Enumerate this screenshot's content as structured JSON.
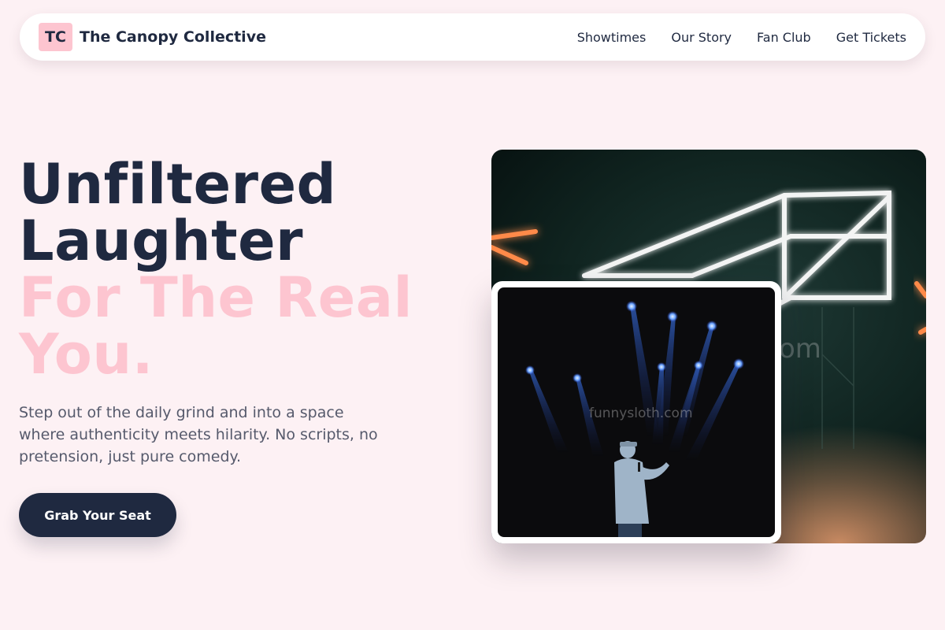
{
  "nav": {
    "logo_mark": "TC",
    "brand_name": "The Canopy Collective",
    "links": [
      {
        "label": "Showtimes"
      },
      {
        "label": "Our Story"
      },
      {
        "label": "Fan Club"
      },
      {
        "label": "Get Tickets"
      }
    ]
  },
  "hero": {
    "title_line1": "Unfiltered",
    "title_line2": "Laughter",
    "title_line3": "For The Real",
    "title_line4": "You.",
    "description": "Step out of the daily grind and into a space where authenticity meets hilarity. No scripts, no pretension, just pure comedy.",
    "cta_label": "Grab Your Seat"
  },
  "images": {
    "front_watermark": "funnysloth.com",
    "back_watermark_fragment": "om"
  },
  "colors": {
    "background": "#fdf1f4",
    "navy": "#1f2940",
    "pink": "#fdc5d0",
    "body_text": "#565a6c"
  }
}
